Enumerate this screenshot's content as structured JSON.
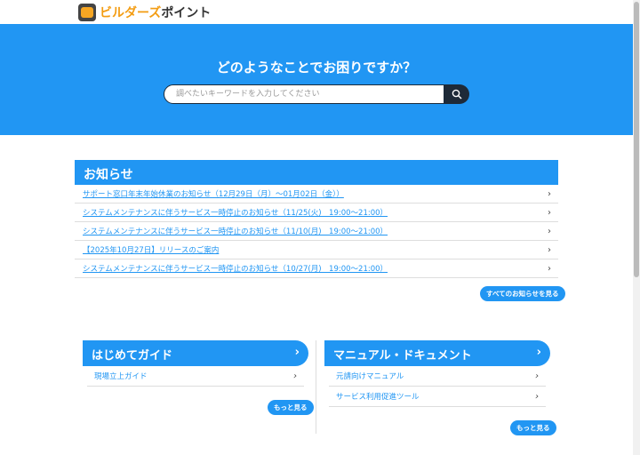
{
  "header": {
    "logo_text": "ビルダーズ",
    "logo_text2": "ポイント"
  },
  "hero": {
    "title": "どのようなことでお困りですか？",
    "search_placeholder": "調べたいキーワードを入力してください"
  },
  "notice": {
    "title": "お知らせ",
    "items": [
      "サポート窓口年末年始休業のお知らせ（12月29日（月）〜01月02日（金））",
      "システムメンテナンスに伴うサービス一時停止のお知らせ（11/25(火)　19:00〜21:00）",
      "システムメンテナンスに伴うサービス一時停止のお知らせ（11/10(月)　19:00〜21:00）",
      "【2025年10月27日】リリースのご案内",
      "システムメンテナンスに伴うサービス一時停止のお知らせ（10/27(月)　19:00〜21:00）"
    ],
    "all_label": "すべてのお知らせを見る"
  },
  "guide": {
    "title": "はじめてガイド",
    "items": [
      "現場立上ガイド"
    ],
    "more": "もっと見る"
  },
  "manual": {
    "title": "マニュアル・ドキュメント",
    "items": [
      "元請向けマニュアル",
      "サービス利用促進ツール"
    ],
    "more": "もっと見る"
  }
}
